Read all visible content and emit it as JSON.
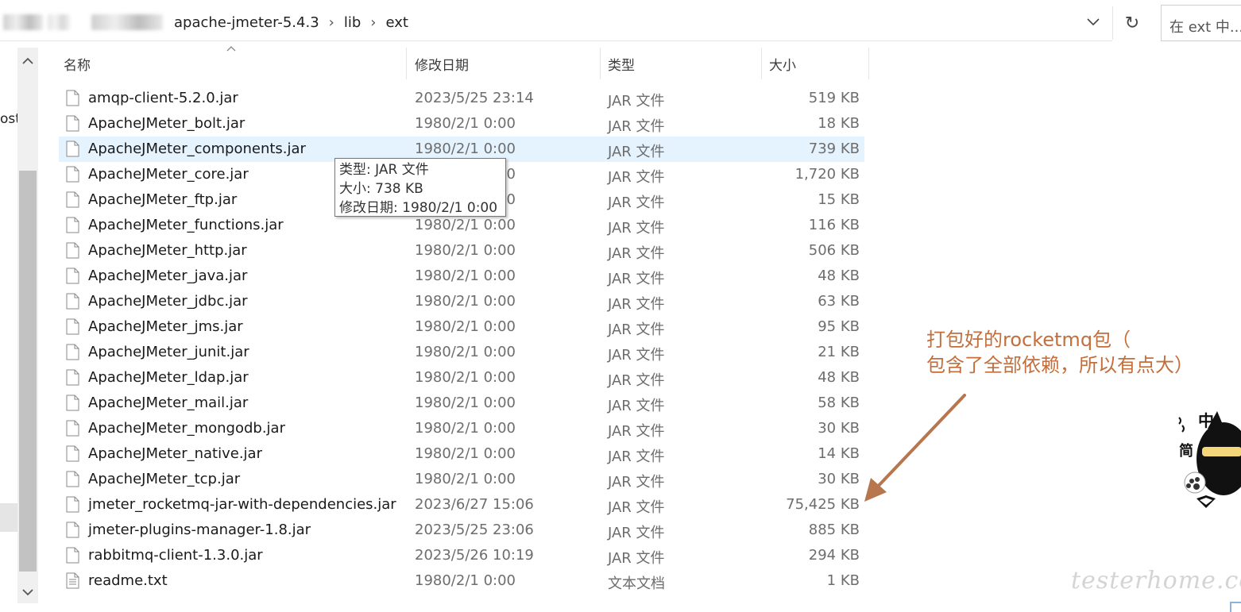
{
  "address_bar": {
    "breadcrumbs": [
      "apache-jmeter-5.4.3",
      "lib",
      "ext"
    ],
    "search_placeholder": "在 ext 中..."
  },
  "nav": {
    "partial_item": "ost"
  },
  "columns": {
    "name": "名称",
    "date": "修改日期",
    "type": "类型",
    "size": "大小"
  },
  "files": [
    {
      "name": "amqp-client-5.2.0.jar",
      "date": "2023/5/25 23:14",
      "type": "JAR 文件",
      "size": "519 KB"
    },
    {
      "name": "ApacheJMeter_bolt.jar",
      "date": "1980/2/1 0:00",
      "type": "JAR 文件",
      "size": "18 KB"
    },
    {
      "name": "ApacheJMeter_components.jar",
      "date": "1980/2/1 0:00",
      "type": "JAR 文件",
      "size": "739 KB"
    },
    {
      "name": "ApacheJMeter_core.jar",
      "date": "1980/2/1 0:00",
      "type": "JAR 文件",
      "size": "1,720 KB"
    },
    {
      "name": "ApacheJMeter_ftp.jar",
      "date": "1980/2/1 0:00",
      "type": "JAR 文件",
      "size": "15 KB"
    },
    {
      "name": "ApacheJMeter_functions.jar",
      "date": "1980/2/1 0:00",
      "type": "JAR 文件",
      "size": "116 KB"
    },
    {
      "name": "ApacheJMeter_http.jar",
      "date": "1980/2/1 0:00",
      "type": "JAR 文件",
      "size": "506 KB"
    },
    {
      "name": "ApacheJMeter_java.jar",
      "date": "1980/2/1 0:00",
      "type": "JAR 文件",
      "size": "48 KB"
    },
    {
      "name": "ApacheJMeter_jdbc.jar",
      "date": "1980/2/1 0:00",
      "type": "JAR 文件",
      "size": "63 KB"
    },
    {
      "name": "ApacheJMeter_jms.jar",
      "date": "1980/2/1 0:00",
      "type": "JAR 文件",
      "size": "95 KB"
    },
    {
      "name": "ApacheJMeter_junit.jar",
      "date": "1980/2/1 0:00",
      "type": "JAR 文件",
      "size": "21 KB"
    },
    {
      "name": "ApacheJMeter_ldap.jar",
      "date": "1980/2/1 0:00",
      "type": "JAR 文件",
      "size": "48 KB"
    },
    {
      "name": "ApacheJMeter_mail.jar",
      "date": "1980/2/1 0:00",
      "type": "JAR 文件",
      "size": "58 KB"
    },
    {
      "name": "ApacheJMeter_mongodb.jar",
      "date": "1980/2/1 0:00",
      "type": "JAR 文件",
      "size": "30 KB"
    },
    {
      "name": "ApacheJMeter_native.jar",
      "date": "1980/2/1 0:00",
      "type": "JAR 文件",
      "size": "14 KB"
    },
    {
      "name": "ApacheJMeter_tcp.jar",
      "date": "1980/2/1 0:00",
      "type": "JAR 文件",
      "size": "30 KB"
    },
    {
      "name": "jmeter_rocketmq-jar-with-dependencies.jar",
      "date": "2023/6/27 15:06",
      "type": "JAR 文件",
      "size": "75,425 KB"
    },
    {
      "name": "jmeter-plugins-manager-1.8.jar",
      "date": "2023/5/25 23:06",
      "type": "JAR 文件",
      "size": "885 KB"
    },
    {
      "name": "rabbitmq-client-1.3.0.jar",
      "date": "2023/5/26 10:19",
      "type": "JAR 文件",
      "size": "294 KB"
    },
    {
      "name": "readme.txt",
      "date": "1980/2/1 0:00",
      "type": "文本文档",
      "size": "1 KB"
    }
  ],
  "tooltip": {
    "type_line": "类型: JAR 文件",
    "size_line": "大小: 738 KB",
    "date_line": "修改日期: 1980/2/1 0:00"
  },
  "annotation": {
    "line1": "打包好的rocketmq包（",
    "line2": "包含了全部依赖，所以有点大）"
  },
  "sticker": {
    "char1": "中",
    "char2": "简"
  },
  "watermark": "testerhome.com",
  "colors": {
    "hover_row": "#e5f3ff",
    "annotation": "#c46e3b",
    "secondary_text": "#6d6d6d"
  }
}
